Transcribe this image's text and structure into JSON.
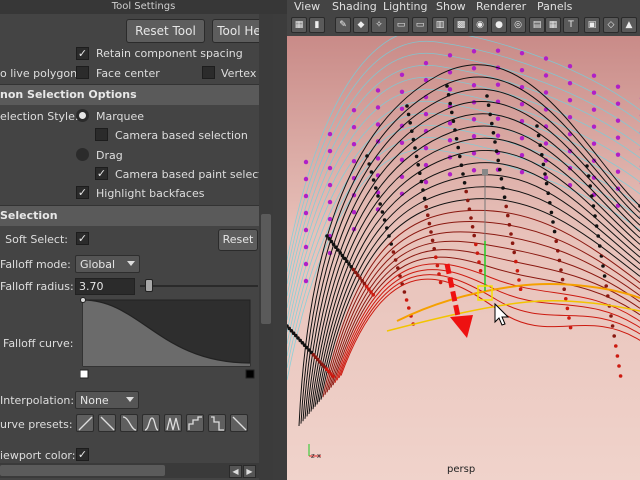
{
  "panel": {
    "title": "Tool Settings",
    "reset_tool": "Reset Tool",
    "tool_help": "Tool Help",
    "retain_spacing": "Retain component spacing",
    "live_polygon_label": "o live polygon:",
    "face_center": "Face center",
    "vertex": "Vertex",
    "section_common": "non Selection Options",
    "selection_style_label": "election Style:",
    "marquee": "Marquee",
    "camera_based_selection": "Camera based selection",
    "drag": "Drag",
    "camera_based_paint": "Camera based paint selection",
    "highlight_backfaces": "Highlight backfaces",
    "section_soft": "Selection",
    "soft_select_label": "Soft Select:",
    "reset": "Reset",
    "falloff_mode_label": "Falloff mode:",
    "falloff_mode_value": "Global",
    "falloff_radius_label": "Falloff radius:",
    "falloff_radius_value": "3.70",
    "falloff_curve_label": "Falloff curve:",
    "interpolation_label": "Interpolation:",
    "interpolation_value": "None",
    "curve_presets_label": "urve presets:",
    "viewport_color_label": "iewport color:",
    "check_glyph": "✓"
  },
  "viewport": {
    "menu": [
      "View",
      "Shading",
      "Lighting",
      "Show",
      "Renderer",
      "Panels"
    ],
    "camera_label": "persp",
    "axis_label": "z x"
  },
  "colors": {
    "accent_selection": "#f5a000",
    "curve_dark": "#111111",
    "curve_red": "#cc1a10",
    "cv_magenta": "#b01fc8",
    "wire_cyan": "#6fd2e0",
    "arrow_red": "#ee1111"
  },
  "icons": [
    "checkbox-check-icon",
    "radio-icon",
    "dropdown-arrow-icon",
    "slider-handle-icon",
    "falloff-curve-icon",
    "curve-preset-icon",
    "viewport-toolbar-icon",
    "red-arrow-annotation-icon",
    "move-manipulator-icon",
    "mouse-cursor-icon"
  ]
}
